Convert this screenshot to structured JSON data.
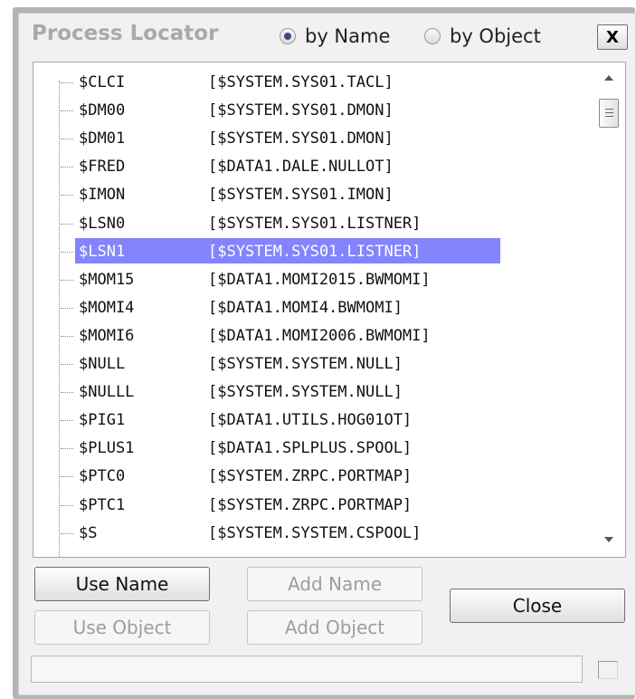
{
  "dialog": {
    "title": "Process Locator",
    "radio_by_name": "by Name",
    "radio_by_object": "by Object",
    "selected_mode": "by Name",
    "close_x": "X"
  },
  "process_list": [
    {
      "name": "$CLCI",
      "path": "[$SYSTEM.SYS01.TACL]"
    },
    {
      "name": "$DM00",
      "path": "[$SYSTEM.SYS01.DMON]"
    },
    {
      "name": "$DM01",
      "path": "[$SYSTEM.SYS01.DMON]"
    },
    {
      "name": "$FRED",
      "path": "[$DATA1.DALE.NULLOT]"
    },
    {
      "name": "$IMON",
      "path": "[$SYSTEM.SYS01.IMON]"
    },
    {
      "name": "$LSN0",
      "path": "[$SYSTEM.SYS01.LISTNER]"
    },
    {
      "name": "$LSN1",
      "path": "[$SYSTEM.SYS01.LISTNER]"
    },
    {
      "name": "$MOM15",
      "path": "[$DATA1.MOMI2015.BWMOMI]"
    },
    {
      "name": "$MOMI4",
      "path": "[$DATA1.MOMI4.BWMOMI]"
    },
    {
      "name": "$MOMI6",
      "path": "[$DATA1.MOMI2006.BWMOMI]"
    },
    {
      "name": "$NULL",
      "path": "[$SYSTEM.SYSTEM.NULL]"
    },
    {
      "name": "$NULLL",
      "path": "[$SYSTEM.SYSTEM.NULL]"
    },
    {
      "name": "$PIG1",
      "path": "[$DATA1.UTILS.HOG01OT]"
    },
    {
      "name": "$PLUS1",
      "path": "[$DATA1.SPLPLUS.SPOOL]"
    },
    {
      "name": "$PTC0",
      "path": "[$SYSTEM.ZRPC.PORTMAP]"
    },
    {
      "name": "$PTC1",
      "path": "[$SYSTEM.ZRPC.PORTMAP]"
    },
    {
      "name": "$S",
      "path": "[$SYSTEM.SYSTEM.CSPOOL]"
    }
  ],
  "selected_process": "$LSN1",
  "buttons": {
    "use_name": "Use Name",
    "use_object": "Use Object",
    "add_name": "Add Name",
    "add_object": "Add Object",
    "close": "Close"
  },
  "status_text": "",
  "icons": {
    "scroll_up": "arrow-up-icon",
    "scroll_down": "arrow-down-icon",
    "scroll_thumb": "scroll-thumb-grip-icon"
  }
}
